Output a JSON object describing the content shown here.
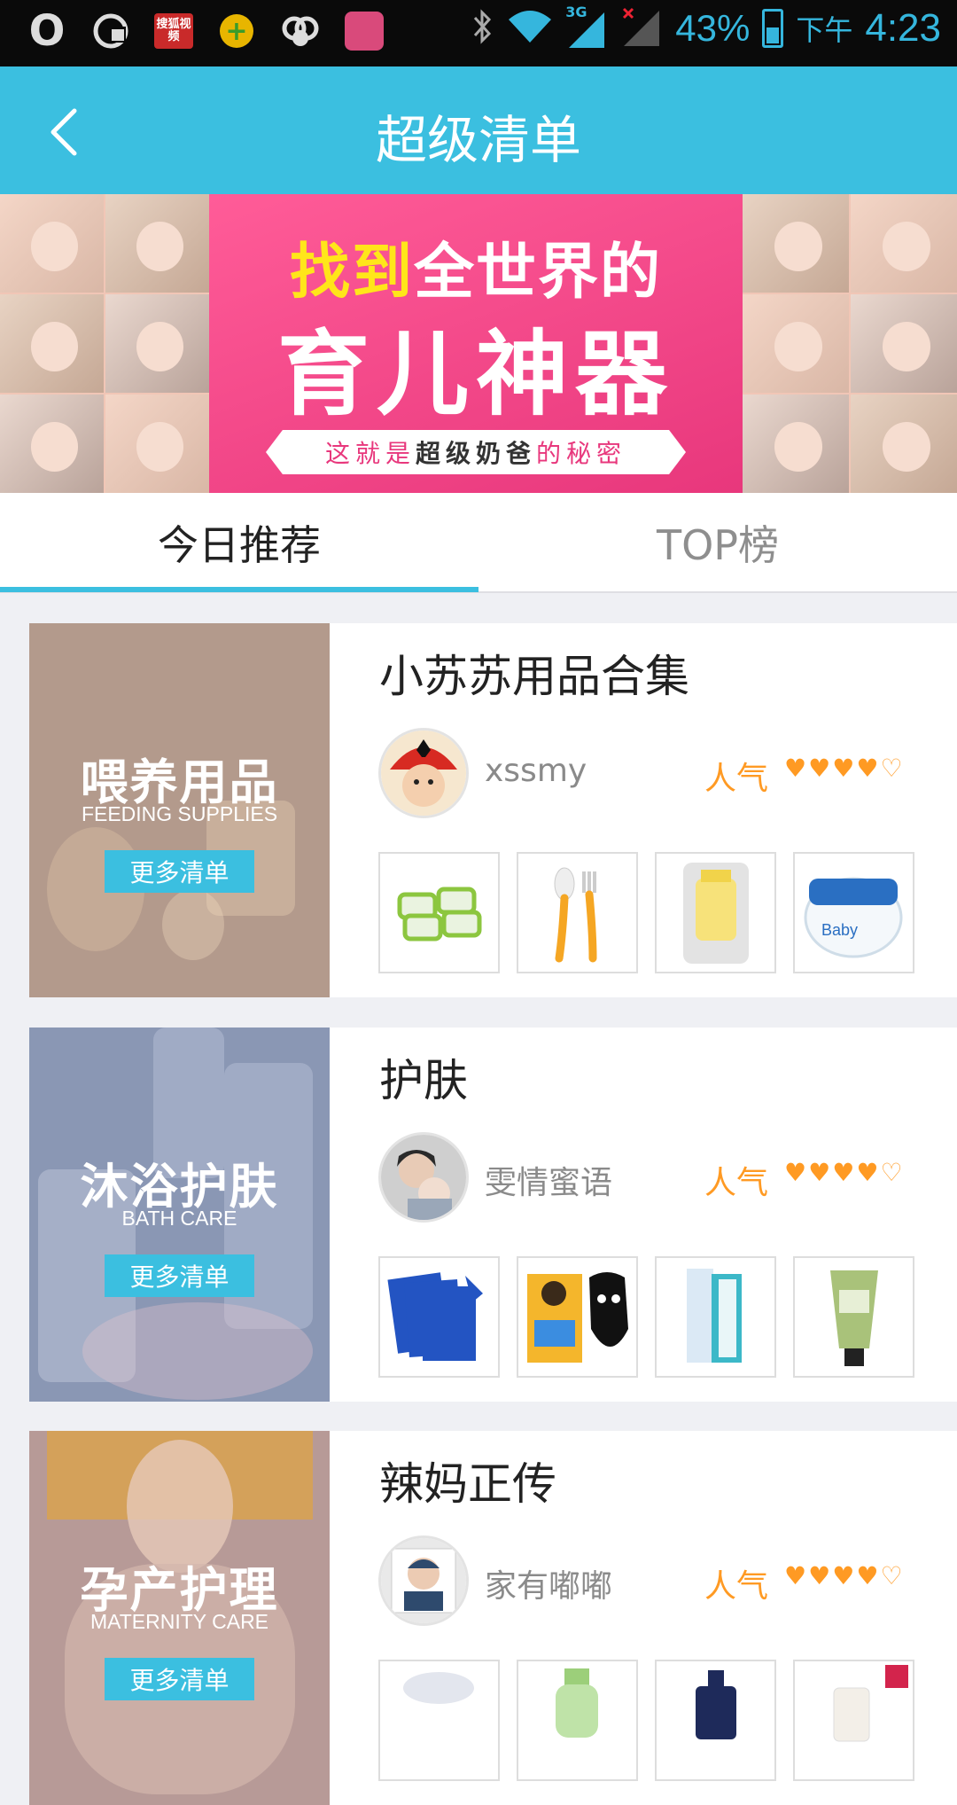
{
  "status_bar": {
    "left_icons": [
      "o-app-icon",
      "baidu-icon",
      "sohu-video-icon",
      "cross-app-icon",
      "gallery-app-icon",
      "pink-app-icon"
    ],
    "sohu_label": "搜狐视频",
    "network": "3G",
    "battery_percent": "43%",
    "ampm": "下午",
    "time": "4:23"
  },
  "header": {
    "title": "超级清单"
  },
  "banner": {
    "line1_highlight": "找到",
    "line1_rest": "全世界的",
    "line2": "育儿神器",
    "ribbon_prefix": "这就是",
    "ribbon_bold": "超级奶爸",
    "ribbon_suffix": "的秘密"
  },
  "tabs": [
    {
      "label": "今日推荐",
      "active": true
    },
    {
      "label": "TOP榜",
      "active": false
    }
  ],
  "cards": [
    {
      "cover_cn": "喂养用品",
      "cover_en": "FEEDING SUPPLIES",
      "more_label": "更多清单",
      "title": "小苏苏用品合集",
      "user": "xssmy",
      "popularity_label": "人气",
      "rating": 4,
      "rating_max": 5
    },
    {
      "cover_cn": "沐浴护肤",
      "cover_en": "BATH CARE",
      "more_label": "更多清单",
      "title": "护肤",
      "user": "雯情蜜语",
      "popularity_label": "人气",
      "rating": 4,
      "rating_max": 5
    },
    {
      "cover_cn": "孕产护理",
      "cover_en": "MATERNITY CARE",
      "more_label": "更多清单",
      "title": "辣妈正传",
      "user": "家有嘟嘟",
      "popularity_label": "人气",
      "rating": 4,
      "rating_max": 5
    }
  ],
  "colors": {
    "accent": "#3bbfe0",
    "popularity": "#ff9a23",
    "banner_pink": "#e8377c"
  }
}
